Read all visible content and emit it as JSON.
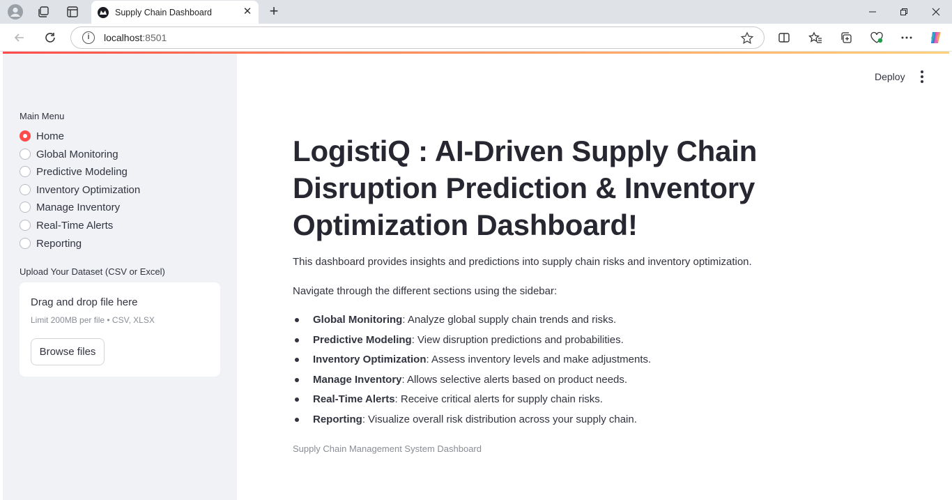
{
  "browser": {
    "tab_title": "Supply Chain Dashboard",
    "url_host": "localhost",
    "url_port": ":8501"
  },
  "app": {
    "deploy_label": "Deploy",
    "accent_color": "#ff4b4b"
  },
  "sidebar": {
    "menu_label": "Main Menu",
    "selected": "Home",
    "items": [
      {
        "label": "Home",
        "selected": true
      },
      {
        "label": "Global Monitoring",
        "selected": false
      },
      {
        "label": "Predictive Modeling",
        "selected": false
      },
      {
        "label": "Inventory Optimization",
        "selected": false
      },
      {
        "label": "Manage Inventory",
        "selected": false
      },
      {
        "label": "Real-Time Alerts",
        "selected": false
      },
      {
        "label": "Reporting",
        "selected": false
      }
    ],
    "upload_label": "Upload Your Dataset (CSV or Excel)",
    "dropzone_title": "Drag and drop file here",
    "dropzone_limit": "Limit 200MB per file • CSV, XLSX",
    "browse_label": "Browse files"
  },
  "main": {
    "title": "LogistiQ : AI-Driven Supply Chain Disruption Prediction & Inventory Optimization Dashboard!",
    "intro": "This dashboard provides insights and predictions into supply chain risks and inventory optimization.",
    "navigate": "Navigate through the different sections using the sidebar:",
    "sections": [
      {
        "name": "Global Monitoring",
        "desc": ": Analyze global supply chain trends and risks."
      },
      {
        "name": "Predictive Modeling",
        "desc": ": View disruption predictions and probabilities."
      },
      {
        "name": "Inventory Optimization",
        "desc": ": Assess inventory levels and make adjustments."
      },
      {
        "name": "Manage Inventory",
        "desc": ": Allows selective alerts based on product needs."
      },
      {
        "name": "Real-Time Alerts",
        "desc": ": Receive critical alerts for supply chain risks."
      },
      {
        "name": "Reporting",
        "desc": ": Visualize overall risk distribution across your supply chain."
      }
    ],
    "caption": "Supply Chain Management System Dashboard"
  }
}
